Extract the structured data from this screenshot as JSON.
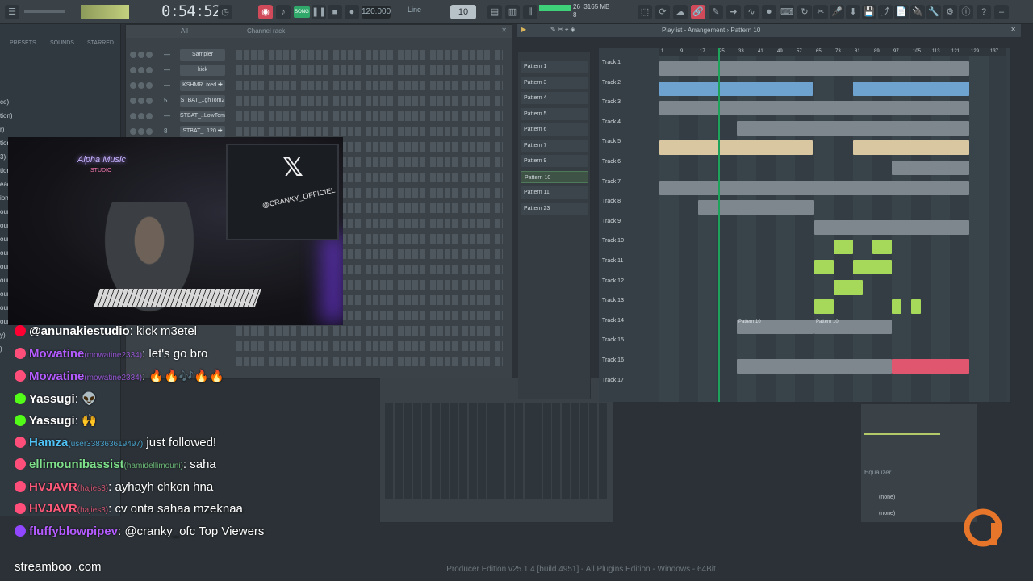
{
  "toolbar": {
    "time": "0:54:52",
    "tempo": "120.000",
    "snap": "Line",
    "pattern": "10",
    "cpu_top": "26",
    "mem": "3165 MB",
    "cpu_bottom": "8",
    "mode_badge": "SONG"
  },
  "browser": {
    "tabs": [
      "PRESETS",
      "SOUNDS",
      "STARRED"
    ],
    "side_labels": [
      "ce)",
      "tion)",
      "r)",
      "tion)",
      "3)",
      "tion)",
      "ead)",
      "ion)",
      "ource 1)",
      "ource 2)",
      "ource 3)",
      "ource 4)",
      "ource 5)",
      "ource 6)",
      "ource 7)",
      "ource 8)",
      "ource 9)",
      "y)",
      ")"
    ]
  },
  "channel_rack": {
    "filter": "All",
    "title": "Channel rack",
    "channels": [
      {
        "num": "—",
        "name": "Sampler"
      },
      {
        "num": "—",
        "name": "kick"
      },
      {
        "num": "—",
        "name": "KSHMR..ixed ✚"
      },
      {
        "num": "5",
        "name": "STBAT_..ghTom2"
      },
      {
        "num": "—",
        "name": "STBAT_..LowTom"
      },
      {
        "num": "8",
        "name": "STBAT_..120 ✚"
      }
    ]
  },
  "webcam": {
    "neon_text": "Alpha Music",
    "neon_sub": "STUDIO",
    "x_logo": "𝕏",
    "handle": "@CRANKY_OFFICIEL"
  },
  "chat": [
    {
      "user": "@anunakiestudio",
      "sub": "",
      "msg": ": kick m3etel",
      "color": "#ffffff",
      "icon": "#ff0033"
    },
    {
      "user": "Mowatine",
      "sub": "(mowatine2334)",
      "msg": ": let's go bro",
      "color": "#b45cff",
      "icon": "#ff4e7a"
    },
    {
      "user": "Mowatine",
      "sub": "(mowatine2334)",
      "msg": ": 🔥🔥🎶🔥🔥",
      "color": "#b45cff",
      "icon": "#ff4e7a"
    },
    {
      "user": "Yassugi",
      "sub": "",
      "msg": ": 👽",
      "color": "#ffffff",
      "icon": "#53fc18"
    },
    {
      "user": "Yassugi",
      "sub": "",
      "msg": ": 🙌",
      "color": "#ffffff",
      "icon": "#53fc18"
    },
    {
      "user": "Hamza",
      "sub": "(user338363619497)",
      "msg": " just followed!",
      "color": "#4fc3f7",
      "icon": "#ff4e7a"
    },
    {
      "user": "ellimounibassist",
      "sub": "(hamidellimouni)",
      "msg": ": saha",
      "color": "#7ee08a",
      "icon": "#ff4e7a"
    },
    {
      "user": "HVJAVR",
      "sub": "(hajies3)",
      "msg": ": ayhayh chkon hna",
      "color": "#ff5a7a",
      "icon": "#ff4e7a"
    },
    {
      "user": "HVJAVR",
      "sub": "(hajies3)",
      "msg": ": cv onta sahaa mzeknaa",
      "color": "#ff5a7a",
      "icon": "#ff4e7a"
    },
    {
      "user": "fluffyblowpipev",
      "sub": "",
      "msg": ": @cranky_ofc Top Viewers",
      "color": "#b45cff",
      "icon": "#9146ff"
    }
  ],
  "chat_footer": "streamboo .com",
  "patterns": [
    "Pattern 1",
    "Pattern 3",
    "Pattern 4",
    "Pattern 5",
    "Pattern 6",
    "Pattern 7",
    "Pattern 9",
    "Pattern 10",
    "Pattern 11",
    "Pattern 23"
  ],
  "playlist": {
    "title": "Playlist - Arrangement › Pattern 10",
    "ruler": [
      "1",
      "9",
      "17",
      "25",
      "33",
      "41",
      "49",
      "57",
      "65",
      "73",
      "81",
      "89",
      "97",
      "105",
      "113",
      "121",
      "129",
      "137"
    ],
    "tracks": [
      "Track 1",
      "Track 2",
      "Track 3",
      "Track 4",
      "Track 5",
      "Track 6",
      "Track 7",
      "Track 8",
      "Track 9",
      "Track 10",
      "Track 11",
      "Track 12",
      "Track 13",
      "Track 14",
      "Track 15",
      "Track 16",
      "Track 17"
    ],
    "clip_labels": {
      "t14a": "Pattern 10",
      "t14b": "Pattern 10"
    }
  },
  "eq": {
    "label": "Equalizer",
    "slot1": "(none)",
    "slot2": "(none)"
  },
  "status": "Producer Edition v25.1.4 [build 4951] - All Plugins Edition - Windows - 64Bit",
  "colors": {
    "accent": "#1ea35a",
    "clip_blue": "#6ea3d0",
    "clip_tan": "#d8c7a0",
    "clip_green": "#a6d85a",
    "clip_red": "#e0566e",
    "clip_grey": "#7d878d"
  }
}
